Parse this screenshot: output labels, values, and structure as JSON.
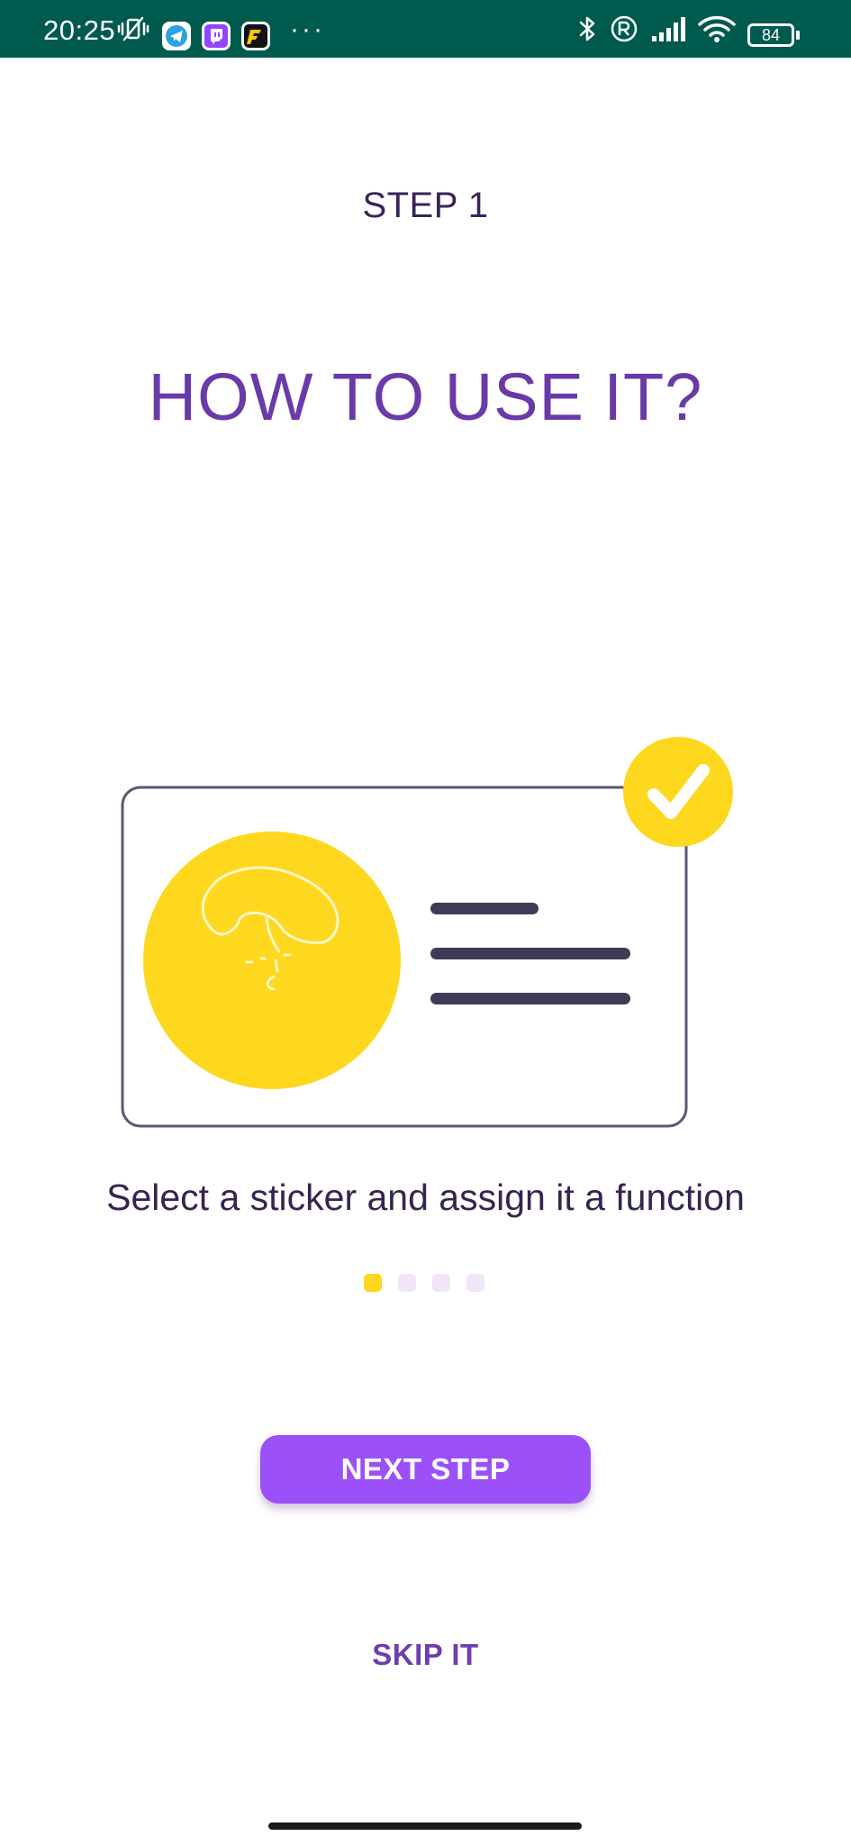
{
  "status_bar": {
    "time": "20:25",
    "battery": "84",
    "background": "#005a4e",
    "more": "···",
    "icons": [
      "mute-vibrate-icon",
      "telegram-icon",
      "twitch-icon",
      "fuel-app-icon",
      "bluetooth-icon",
      "registered-icon",
      "signal-icon",
      "wifi-icon",
      "battery-icon"
    ]
  },
  "onboarding": {
    "step_label": "STEP 1",
    "title": "HOW TO USE IT?",
    "caption": "Select a sticker and assign it a function",
    "pager": {
      "total": 4,
      "current": 1,
      "active_color": "#fed81e",
      "inactive_color": "#f1e6f8"
    },
    "next_button": "NEXT STEP",
    "skip_link": "SKIP IT"
  },
  "colors": {
    "accent_purple": "#9b50f8",
    "title_purple": "#6a3aa8",
    "sticker_yellow": "#fed81e",
    "text_dark": "#36244f"
  }
}
